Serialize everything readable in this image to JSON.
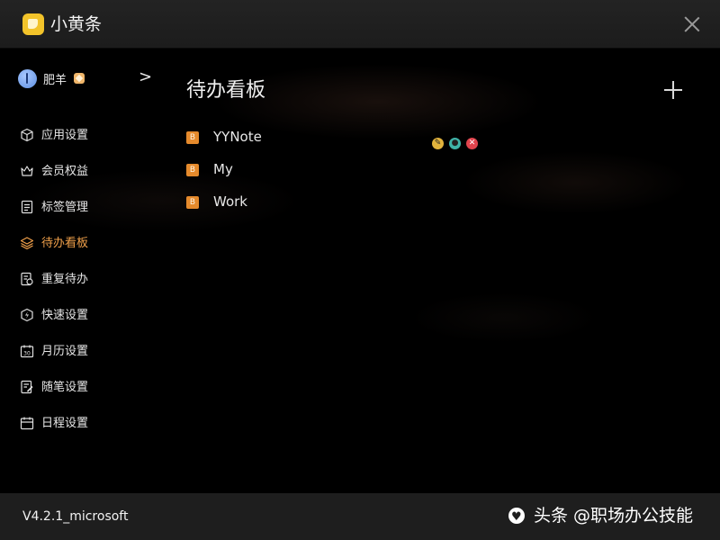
{
  "window": {
    "title": "小黄条"
  },
  "profile": {
    "name": "肥羊"
  },
  "sidebar": {
    "items": [
      {
        "label": "应用设置",
        "icon": "cube-icon"
      },
      {
        "label": "会员权益",
        "icon": "crown-icon"
      },
      {
        "label": "标签管理",
        "icon": "list-icon"
      },
      {
        "label": "待办看板",
        "icon": "layers-icon",
        "active": true
      },
      {
        "label": "重复待办",
        "icon": "repeat-icon"
      },
      {
        "label": "快速设置",
        "icon": "lightning-icon"
      },
      {
        "label": "月历设置",
        "icon": "calendar-30-icon"
      },
      {
        "label": "随笔设置",
        "icon": "note-edit-icon"
      },
      {
        "label": "日程设置",
        "icon": "calendar-icon"
      }
    ]
  },
  "main": {
    "title": "待办看板",
    "boards": [
      {
        "badge": "B",
        "name": "YYNote",
        "show_actions": true
      },
      {
        "badge": "B",
        "name": "My",
        "show_actions": false
      },
      {
        "badge": "B",
        "name": "Work",
        "show_actions": false
      }
    ]
  },
  "footer": {
    "version": "V4.2.1_microsoft",
    "watermark": "头条 @职场办公技能"
  },
  "colors": {
    "accent": "#f0a04a",
    "badge": "#e58a2c",
    "edit": "#e2b33c",
    "view": "#3fb3a8",
    "delete": "#e0444d"
  }
}
